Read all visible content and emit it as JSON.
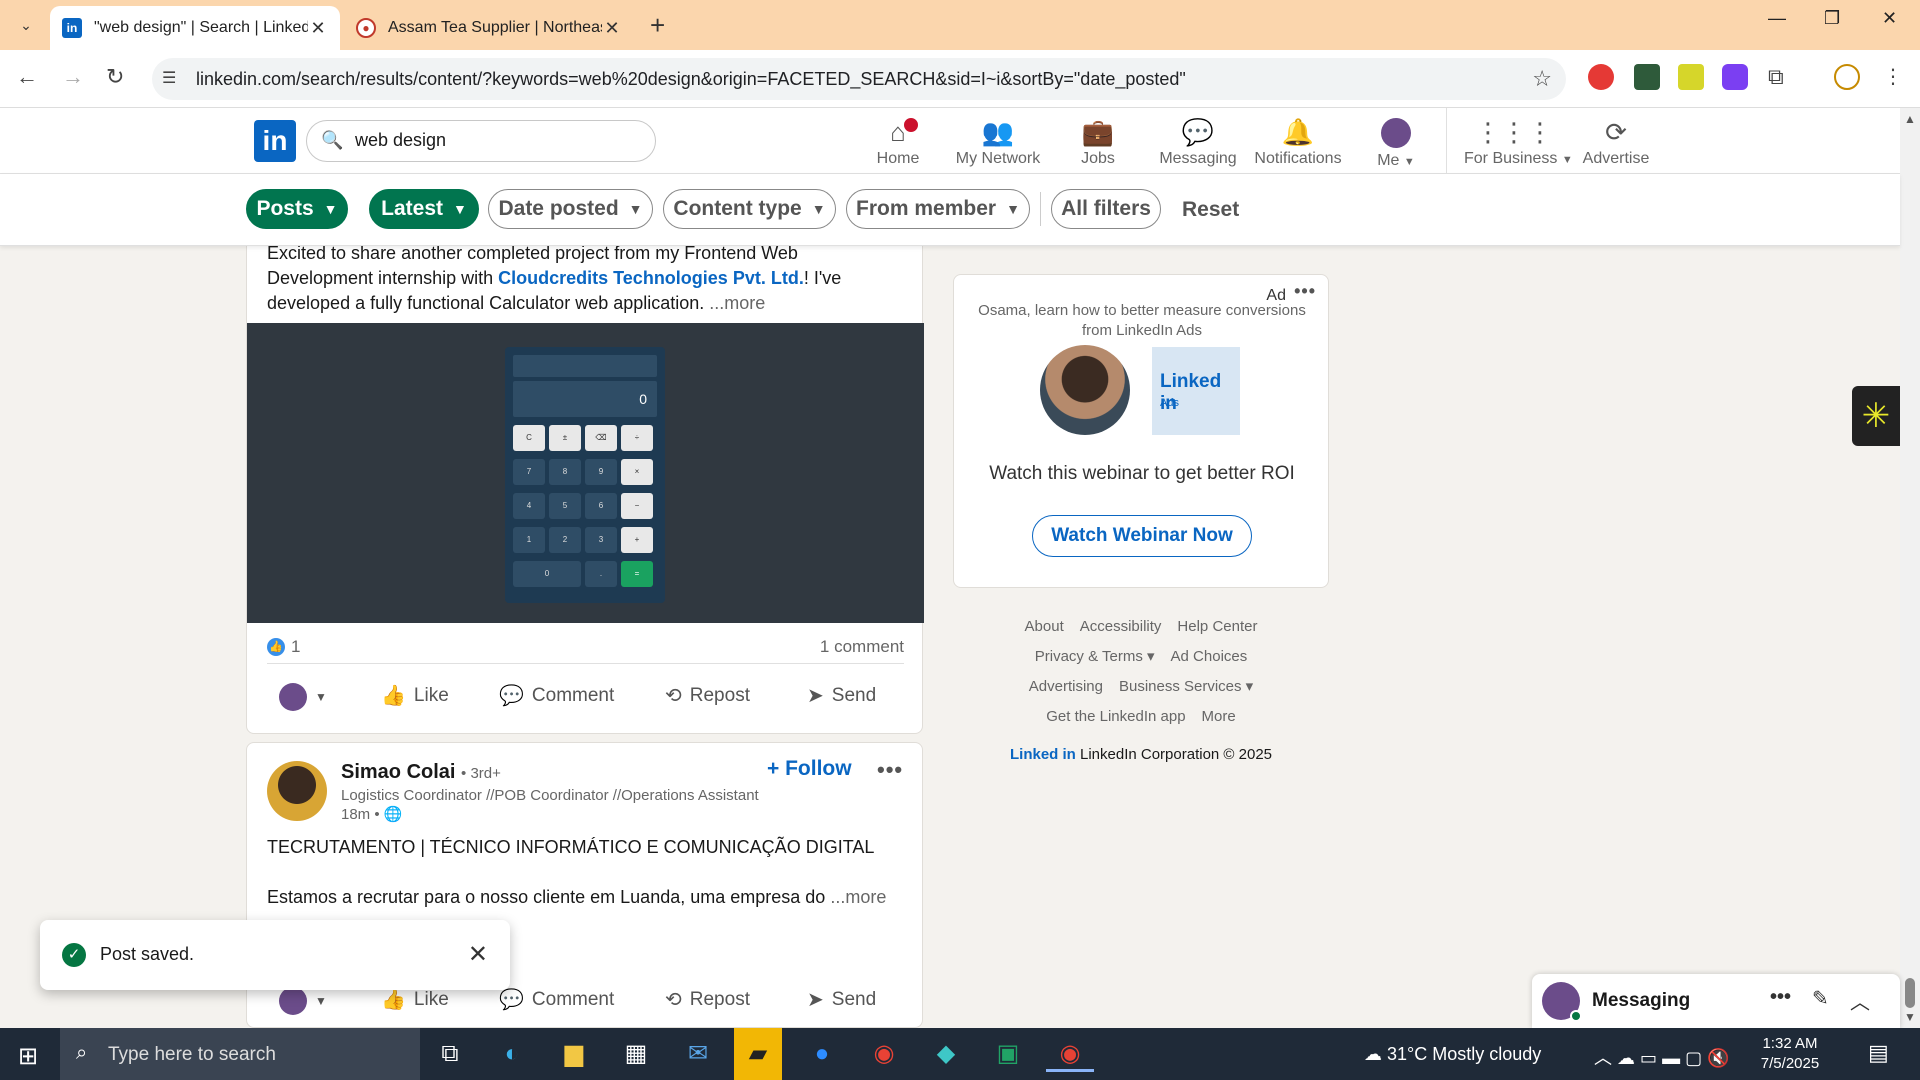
{
  "browser": {
    "tabs": [
      {
        "title": "\"web design\" | Search | LinkedIn",
        "favicon": "linkedin-icon",
        "active": true
      },
      {
        "title": "Assam Tea Supplier | Northeast",
        "favicon": "tea-site-icon",
        "active": false
      }
    ],
    "url": "linkedin.com/search/results/content/?keywords=web%20design&origin=FACETED_SEARCH&sid=I~i&sortBy=\"date_posted\""
  },
  "linkedin": {
    "search_value": "web design",
    "nav": [
      {
        "label": "Home",
        "icon": "home-icon"
      },
      {
        "label": "My Network",
        "icon": "network-icon"
      },
      {
        "label": "Jobs",
        "icon": "briefcase-icon"
      },
      {
        "label": "Messaging",
        "icon": "message-icon"
      },
      {
        "label": "Notifications",
        "icon": "bell-icon"
      },
      {
        "label": "Me",
        "icon": "avatar"
      },
      {
        "label": "For Business",
        "icon": "grid-icon"
      },
      {
        "label": "Advertise",
        "icon": "advertise-icon"
      }
    ],
    "filters": {
      "posts": "Posts",
      "latest": "Latest",
      "date_posted": "Date posted",
      "content_type": "Content type",
      "from_member": "From member",
      "all_filters": "All filters",
      "reset": "Reset"
    }
  },
  "post1": {
    "text_before": "Excited to share another completed project from my Frontend Web Development internship with ",
    "company_link": "Cloudcredits Technologies Pvt. Ltd.",
    "text_after": "! I've developed a fully functional Calculator web application.",
    "more": "...more",
    "calculator": {
      "display": "0",
      "keys": [
        "C",
        "±",
        "⌫",
        "÷",
        "7",
        "8",
        "9",
        "×",
        "4",
        "5",
        "6",
        "−",
        "1",
        "2",
        "3",
        "+",
        "0",
        ".",
        "="
      ]
    },
    "reactions": "1",
    "comments": "1 comment"
  },
  "actions": {
    "like": "Like",
    "comment": "Comment",
    "repost": "Repost",
    "send": "Send"
  },
  "post2": {
    "author": "Simao Colai",
    "degree": "• 3rd+",
    "headline": "Logistics Coordinator //POB Coordinator //Operations Assistant",
    "time": "18m •",
    "follow": "Follow",
    "title": "TECRUTAMENTO | TÉCNICO INFORMÁTICO E COMUNICAÇÃO DIGITAL",
    "body": "Estamos a recrutar para o nosso cliente em Luanda, uma empresa do",
    "more": "...more"
  },
  "ad": {
    "label": "Ad",
    "message": "Osama, learn how to better measure conversions from LinkedIn Ads",
    "logo_text": "Linked in",
    "logo_sub": "Ads",
    "cta_text": "Watch this webinar to get better ROI",
    "button": "Watch Webinar Now"
  },
  "footer": {
    "row1": [
      "About",
      "Accessibility",
      "Help Center"
    ],
    "row2": [
      "Privacy & Terms ▾",
      "Ad Choices"
    ],
    "row3": [
      "Advertising",
      "Business Services ▾"
    ],
    "row4": [
      "Get the LinkedIn app",
      "More"
    ],
    "copyright_logo": "Linked in",
    "copyright": "LinkedIn Corporation © 2025"
  },
  "toast": {
    "message": "Post saved."
  },
  "messaging": {
    "title": "Messaging"
  },
  "taskbar": {
    "search_placeholder": "Type here to search",
    "weather": "31°C  Mostly cloudy",
    "time": "1:32 AM",
    "date": "7/5/2025"
  },
  "colors": {
    "linkedin_blue": "#0a66c2",
    "filter_green": "#01754f",
    "tabbar": "#fbd6ad"
  }
}
